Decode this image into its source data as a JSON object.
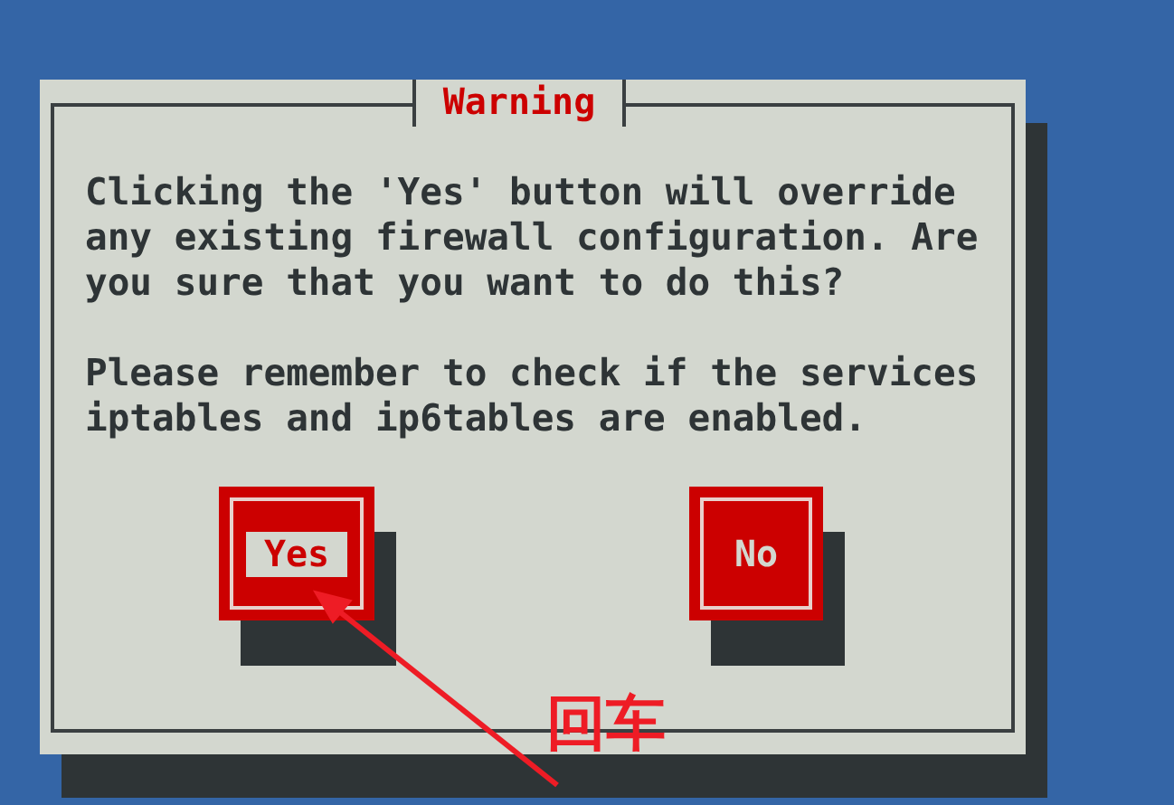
{
  "dialog": {
    "title": "Warning",
    "paragraphs": [
      "Clicking the 'Yes' button will override any existing firewall configuration. Are you sure that you want to do this?",
      "Please remember to check if the services iptables and ip6tables are enabled."
    ],
    "buttons": [
      {
        "label": "Yes",
        "selected": true
      },
      {
        "label": "No",
        "selected": false
      }
    ]
  },
  "annotation": {
    "label": "回车"
  }
}
